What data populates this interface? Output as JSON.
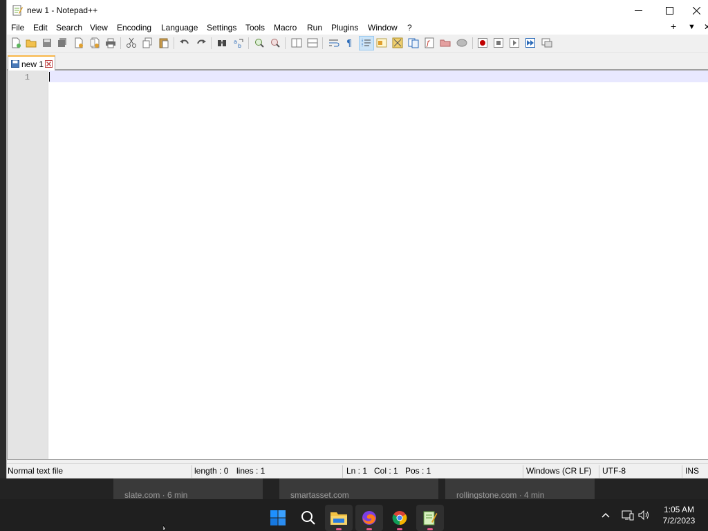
{
  "window": {
    "title": "new 1 - Notepad++"
  },
  "menu": {
    "items": [
      "File",
      "Edit",
      "Search",
      "View",
      "Encoding",
      "Language",
      "Settings",
      "Tools",
      "Macro",
      "Run",
      "Plugins",
      "Window",
      "?"
    ],
    "right": {
      "add": "+",
      "dropdown": "▼",
      "close": "✕"
    }
  },
  "toolbar": {
    "icons": [
      "new-file-icon",
      "open-file-icon",
      "save-icon",
      "save-all-icon",
      "close-icon",
      "close-all-icon",
      "print-icon",
      "cut-icon",
      "copy-icon",
      "paste-icon",
      "undo-icon",
      "redo-icon",
      "find-icon",
      "replace-icon",
      "zoom-in-icon",
      "zoom-out-icon",
      "sync-vertical-icon",
      "sync-horizontal-icon",
      "word-wrap-icon",
      "show-all-chars-icon",
      "indent-guide-icon",
      "user-language-icon",
      "document-map-icon",
      "function-list-icon",
      "folder-workspace-icon",
      "monitoring-icon",
      "record-macro-icon",
      "stop-macro-icon",
      "play-macro-icon",
      "run-macro-multiple-icon",
      "save-macro-icon"
    ]
  },
  "tabs": [
    {
      "label": "new 1"
    }
  ],
  "editor": {
    "line_numbers": [
      "1"
    ]
  },
  "statusbar": {
    "file_type": "Normal text file",
    "length": "length : 0",
    "lines": "lines : 1",
    "ln": "Ln : 1",
    "col": "Col : 1",
    "pos": "Pos : 1",
    "eol": "Windows (CR LF)",
    "encoding": "UTF-8",
    "mode": "INS"
  },
  "desktop": {
    "thumbnails": [
      "slate.com · 6 min",
      "smartasset.com",
      "rollingstone.com · 4 min"
    ]
  },
  "taskbar": {
    "time": "1:05 AM",
    "date": "7/2/2023"
  },
  "colors": {
    "tab_accent": "#f9b646",
    "current_line": "#e8e8ff",
    "active_tool": "#cce4f7",
    "taskbar": "#1f1f1f"
  }
}
